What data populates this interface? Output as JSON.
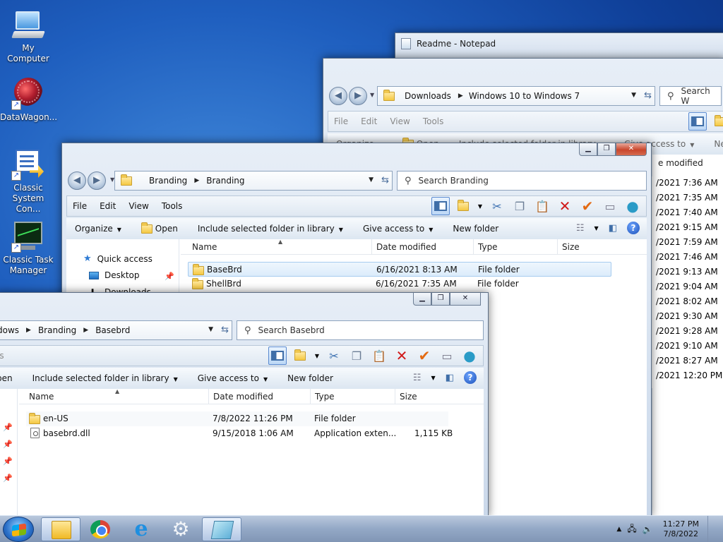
{
  "desktop": {
    "icons": [
      {
        "label": "My Computer",
        "icon": "computer-icon"
      },
      {
        "label": "DataWagon...",
        "icon": "datawagon-icon"
      },
      {
        "label": "Classic System Con...",
        "icon": "control-panel-icon"
      },
      {
        "label": "Classic Task Manager",
        "icon": "task-manager-icon"
      }
    ]
  },
  "notepad": {
    "title": "Readme - Notepad"
  },
  "downloads_window": {
    "breadcrumbs": [
      "Downloads",
      "Windows 10 to Windows 7"
    ],
    "search_placeholder": "Search W",
    "menu": [
      "File",
      "Edit",
      "View",
      "Tools"
    ],
    "commands": [
      "Organize",
      "Open",
      "Include selected folder in library",
      "Give access to",
      "New fold"
    ],
    "column_partial": "e modified",
    "dates": [
      "/2021 7:36 AM",
      "/2021 7:35 AM",
      "/2021 7:40 AM",
      "/2021 9:15 AM",
      "/2021 7:59 AM",
      "/2021 7:46 AM",
      "/2021 9:13 AM",
      "/2021 9:04 AM",
      "/2021 8:02 AM",
      "/2021 9:30 AM",
      "/2021 9:28 AM",
      "/2021 9:10 AM",
      "/2021 8:27 AM",
      "/2021 12:20 PM"
    ]
  },
  "branding_window": {
    "breadcrumbs": [
      "Branding",
      "Branding"
    ],
    "search_placeholder": "Search Branding",
    "menu": [
      "File",
      "Edit",
      "View",
      "Tools"
    ],
    "commands": [
      "Organize",
      "Open",
      "Include selected folder in library",
      "Give access to",
      "New folder"
    ],
    "nav": [
      {
        "label": "Quick access"
      },
      {
        "label": "Desktop"
      },
      {
        "label": "Downloads"
      }
    ],
    "columns": [
      "Name",
      "Date modified",
      "Type",
      "Size"
    ],
    "rows": [
      {
        "name": "BaseBrd",
        "date": "6/16/2021 8:13 AM",
        "type": "File folder",
        "size": ""
      },
      {
        "name": "ShellBrd",
        "date": "6/16/2021 7:35 AM",
        "type": "File folder",
        "size": ""
      }
    ]
  },
  "basebrd_window": {
    "breadcrumbs": [
      "dows",
      "Branding",
      "Basebrd"
    ],
    "search_placeholder": "Search Basebrd",
    "menu_partial": "ls",
    "commands": [
      "pen",
      "Include selected folder in library",
      "Give access to",
      "New folder"
    ],
    "columns": [
      "Name",
      "Date modified",
      "Type",
      "Size"
    ],
    "rows": [
      {
        "name": "en-US",
        "date": "7/8/2022 11:26 PM",
        "type": "File folder",
        "size": ""
      },
      {
        "name": "basebrd.dll",
        "date": "9/15/2018 1:06 AM",
        "type": "Application exten...",
        "size": "1,115 KB"
      }
    ]
  },
  "taskbar": {
    "clock_time": "11:27 PM",
    "clock_date": "7/8/2022",
    "apps": [
      "file-explorer",
      "chrome",
      "internet-explorer",
      "settings",
      "notepad"
    ]
  }
}
